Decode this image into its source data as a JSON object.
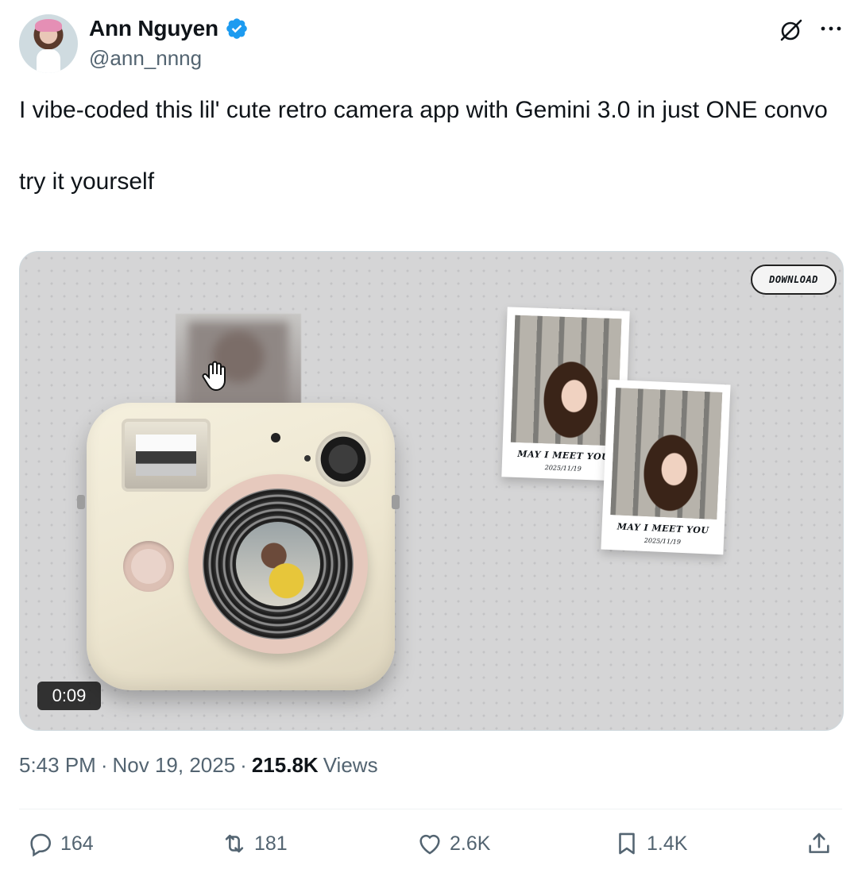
{
  "author": {
    "name": "Ann Nguyen",
    "handle": "@ann_nnng",
    "verified": true,
    "avatar_icon": "avatar-photo"
  },
  "tweet": {
    "text": "I vibe-coded this lil' cute retro camera app with Gemini 3.0 in just ONE convo\n\ntry it yourself"
  },
  "media": {
    "download_label": "DOWNLOAD",
    "video_time": "0:09",
    "polaroids": [
      {
        "caption": "MAY I MEET YOU",
        "date": "2025/11/19"
      },
      {
        "caption": "MAY I MEET YOU",
        "date": "2025/11/19"
      }
    ]
  },
  "meta": {
    "time": "5:43 PM",
    "separator": "·",
    "date": "Nov 19, 2025",
    "views_count": "215.8K",
    "views_label": "Views"
  },
  "actions": {
    "replies": "164",
    "reposts": "181",
    "likes": "2.6K",
    "bookmarks": "1.4K"
  },
  "colors": {
    "verified": "#1d9bf0",
    "secondary_text": "#536471",
    "primary_text": "#0f1419"
  }
}
